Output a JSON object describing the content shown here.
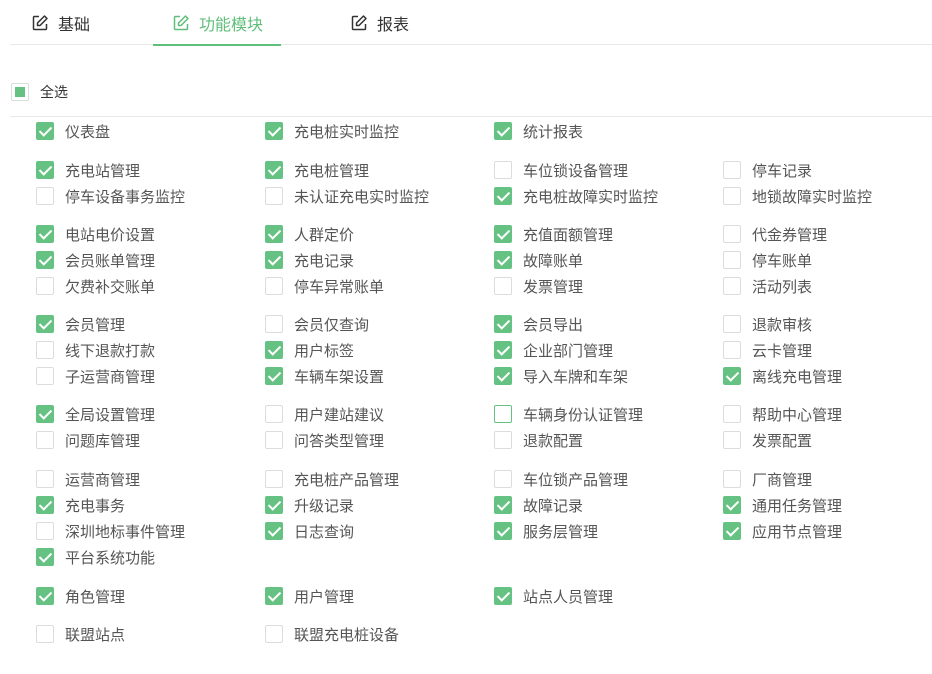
{
  "tabs": [
    {
      "label": "基础",
      "active": false,
      "icon": "edit-icon"
    },
    {
      "label": "功能模块",
      "active": true,
      "icon": "edit-icon"
    },
    {
      "label": "报表",
      "active": false,
      "icon": "edit-icon"
    }
  ],
  "select_all": {
    "label": "全选",
    "state": "indeterminate"
  },
  "colors": {
    "accent": "#5fbf7a",
    "checkbox": "#66c283",
    "border": "#dcdcdc",
    "text": "#555555"
  },
  "groups": [
    {
      "items": [
        {
          "label": "仪表盘",
          "checked": true
        },
        {
          "label": "充电桩实时监控",
          "checked": true
        },
        {
          "label": "统计报表",
          "checked": true
        }
      ]
    },
    {
      "items": [
        {
          "label": "充电站管理",
          "checked": true
        },
        {
          "label": "充电桩管理",
          "checked": true
        },
        {
          "label": "车位锁设备管理",
          "checked": false
        },
        {
          "label": "停车记录",
          "checked": false
        },
        {
          "label": "停车设备事务监控",
          "checked": false
        },
        {
          "label": "未认证充电实时监控",
          "checked": false
        },
        {
          "label": "充电桩故障实时监控",
          "checked": true
        },
        {
          "label": "地锁故障实时监控",
          "checked": false
        }
      ]
    },
    {
      "items": [
        {
          "label": "电站电价设置",
          "checked": true
        },
        {
          "label": "人群定价",
          "checked": true
        },
        {
          "label": "充值面额管理",
          "checked": true
        },
        {
          "label": "代金券管理",
          "checked": false
        },
        {
          "label": "会员账单管理",
          "checked": true
        },
        {
          "label": "充电记录",
          "checked": true
        },
        {
          "label": "故障账单",
          "checked": true
        },
        {
          "label": "停车账单",
          "checked": false
        },
        {
          "label": "欠费补交账单",
          "checked": false
        },
        {
          "label": "停车异常账单",
          "checked": false
        },
        {
          "label": "发票管理",
          "checked": false
        },
        {
          "label": "活动列表",
          "checked": false
        }
      ]
    },
    {
      "items": [
        {
          "label": "会员管理",
          "checked": true
        },
        {
          "label": "会员仅查询",
          "checked": false
        },
        {
          "label": "会员导出",
          "checked": true
        },
        {
          "label": "退款审核",
          "checked": false
        },
        {
          "label": "线下退款打款",
          "checked": false
        },
        {
          "label": "用户标签",
          "checked": true
        },
        {
          "label": "企业部门管理",
          "checked": true
        },
        {
          "label": "云卡管理",
          "checked": false
        },
        {
          "label": "子运营商管理",
          "checked": false
        },
        {
          "label": "车辆车架设置",
          "checked": true
        },
        {
          "label": "导入车牌和车架",
          "checked": true
        },
        {
          "label": "离线充电管理",
          "checked": true
        }
      ]
    },
    {
      "items": [
        {
          "label": "全局设置管理",
          "checked": true
        },
        {
          "label": "用户建站建议",
          "checked": false
        },
        {
          "label": "车辆身份认证管理",
          "checked": false,
          "focused": true
        },
        {
          "label": "帮助中心管理",
          "checked": false
        },
        {
          "label": "问题库管理",
          "checked": false
        },
        {
          "label": "问答类型管理",
          "checked": false
        },
        {
          "label": "退款配置",
          "checked": false
        },
        {
          "label": "发票配置",
          "checked": false
        }
      ]
    },
    {
      "items": [
        {
          "label": "运营商管理",
          "checked": false
        },
        {
          "label": "充电桩产品管理",
          "checked": false
        },
        {
          "label": "车位锁产品管理",
          "checked": false
        },
        {
          "label": "厂商管理",
          "checked": false
        },
        {
          "label": "充电事务",
          "checked": true
        },
        {
          "label": "升级记录",
          "checked": true
        },
        {
          "label": "故障记录",
          "checked": true
        },
        {
          "label": "通用任务管理",
          "checked": true
        },
        {
          "label": "深圳地标事件管理",
          "checked": false
        },
        {
          "label": "日志查询",
          "checked": true
        },
        {
          "label": "服务层管理",
          "checked": true
        },
        {
          "label": "应用节点管理",
          "checked": true
        },
        {
          "label": "平台系统功能",
          "checked": true
        }
      ]
    },
    {
      "items": [
        {
          "label": "角色管理",
          "checked": true
        },
        {
          "label": "用户管理",
          "checked": true
        },
        {
          "label": "站点人员管理",
          "checked": true
        }
      ]
    },
    {
      "items": [
        {
          "label": "联盟站点",
          "checked": false
        },
        {
          "label": "联盟充电桩设备",
          "checked": false
        }
      ]
    }
  ]
}
